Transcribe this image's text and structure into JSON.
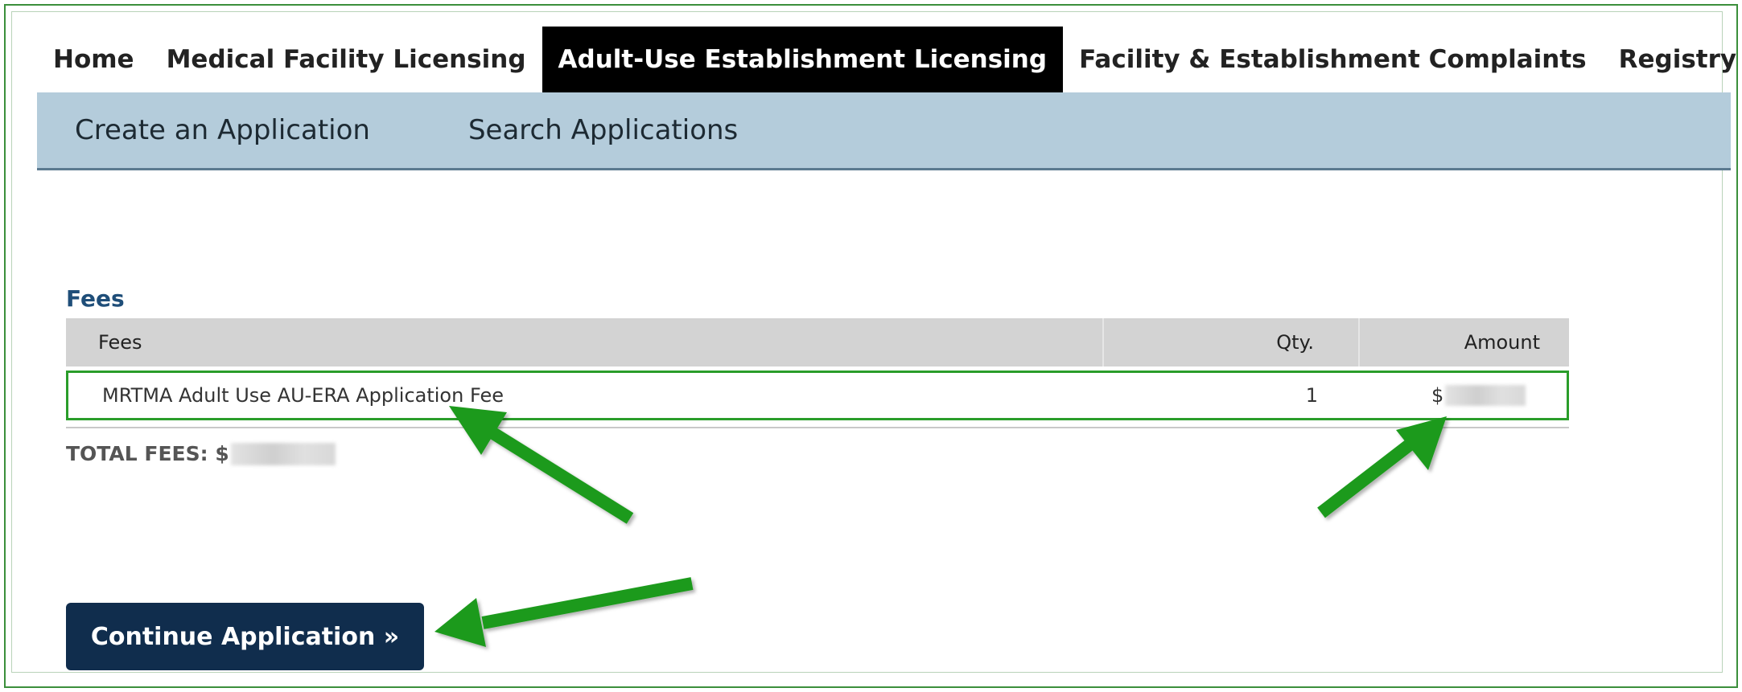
{
  "top_nav": {
    "tabs": [
      {
        "label": "Home",
        "active": false
      },
      {
        "label": "Medical Facility Licensing",
        "active": false
      },
      {
        "label": "Adult-Use Establishment Licensing",
        "active": true
      },
      {
        "label": "Facility & Establishment Complaints",
        "active": false
      },
      {
        "label": "Registry Cards",
        "active": false
      }
    ]
  },
  "sub_nav": {
    "links": [
      "Create an Application",
      "Search Applications"
    ]
  },
  "fees": {
    "section_title": "Fees",
    "columns": {
      "fee": "Fees",
      "qty": "Qty.",
      "amount": "Amount"
    },
    "rows": [
      {
        "fee": "MRTMA Adult Use AU-ERA Application Fee",
        "qty": "1",
        "amount_prefix": "$",
        "amount_redacted": true
      }
    ],
    "total_label": "TOTAL FEES: $",
    "total_redacted": true
  },
  "actions": {
    "continue_label": "Continue Application »"
  },
  "colors": {
    "active_tab": "#000000",
    "subnav_bg": "#b4ccdb",
    "button_bg": "#102d4d",
    "highlight_green": "#2a9d2a",
    "arrow_green": "#1f9a1f"
  },
  "annotations": {
    "arrows": [
      "arrow-to-fee-name",
      "arrow-to-amount",
      "arrow-to-continue-button"
    ]
  }
}
